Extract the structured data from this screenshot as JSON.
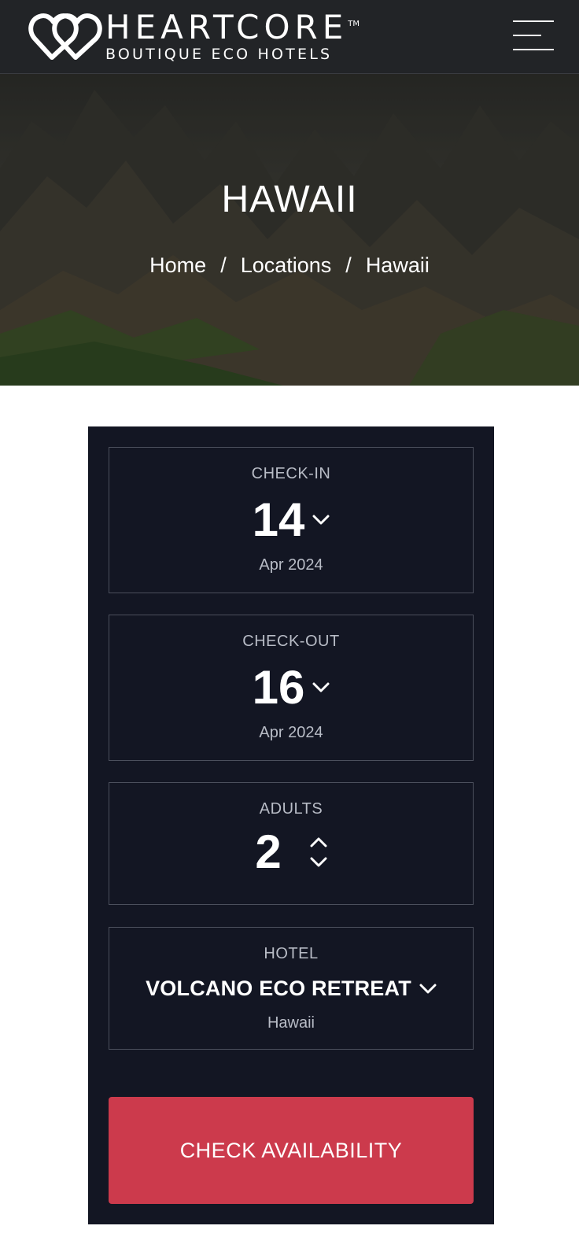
{
  "header": {
    "brand_name": "HEARTCORE",
    "brand_tm": "TM",
    "brand_tagline": "BOUTIQUE ECO HOTELS",
    "logo_icon": "double-heart-icon",
    "menu_icon": "hamburger-menu-icon"
  },
  "hero": {
    "title": "HAWAII",
    "breadcrumb": {
      "home": "Home",
      "separator": "/",
      "locations": "Locations",
      "current": "Hawaii"
    }
  },
  "booking": {
    "checkin": {
      "label": "CHECK-IN",
      "day": "14",
      "month_year": "Apr 2024",
      "icon": "chevron-down-icon"
    },
    "checkout": {
      "label": "CHECK-OUT",
      "day": "16",
      "month_year": "Apr 2024",
      "icon": "chevron-down-icon"
    },
    "adults": {
      "label": "ADULTS",
      "value": "2",
      "up_icon": "chevron-up-icon",
      "down_icon": "chevron-down-icon"
    },
    "hotel": {
      "label": "HOTEL",
      "name": "VOLCANO ECO RETREAT",
      "location": "Hawaii",
      "icon": "chevron-down-icon"
    },
    "cta_label": "CHECK AVAILABILITY"
  },
  "colors": {
    "header_bg": "#222427",
    "panel_bg": "#131623",
    "accent": "#cc3a4c",
    "border": "#4b4f5c",
    "muted_text": "#b8bcc6"
  }
}
